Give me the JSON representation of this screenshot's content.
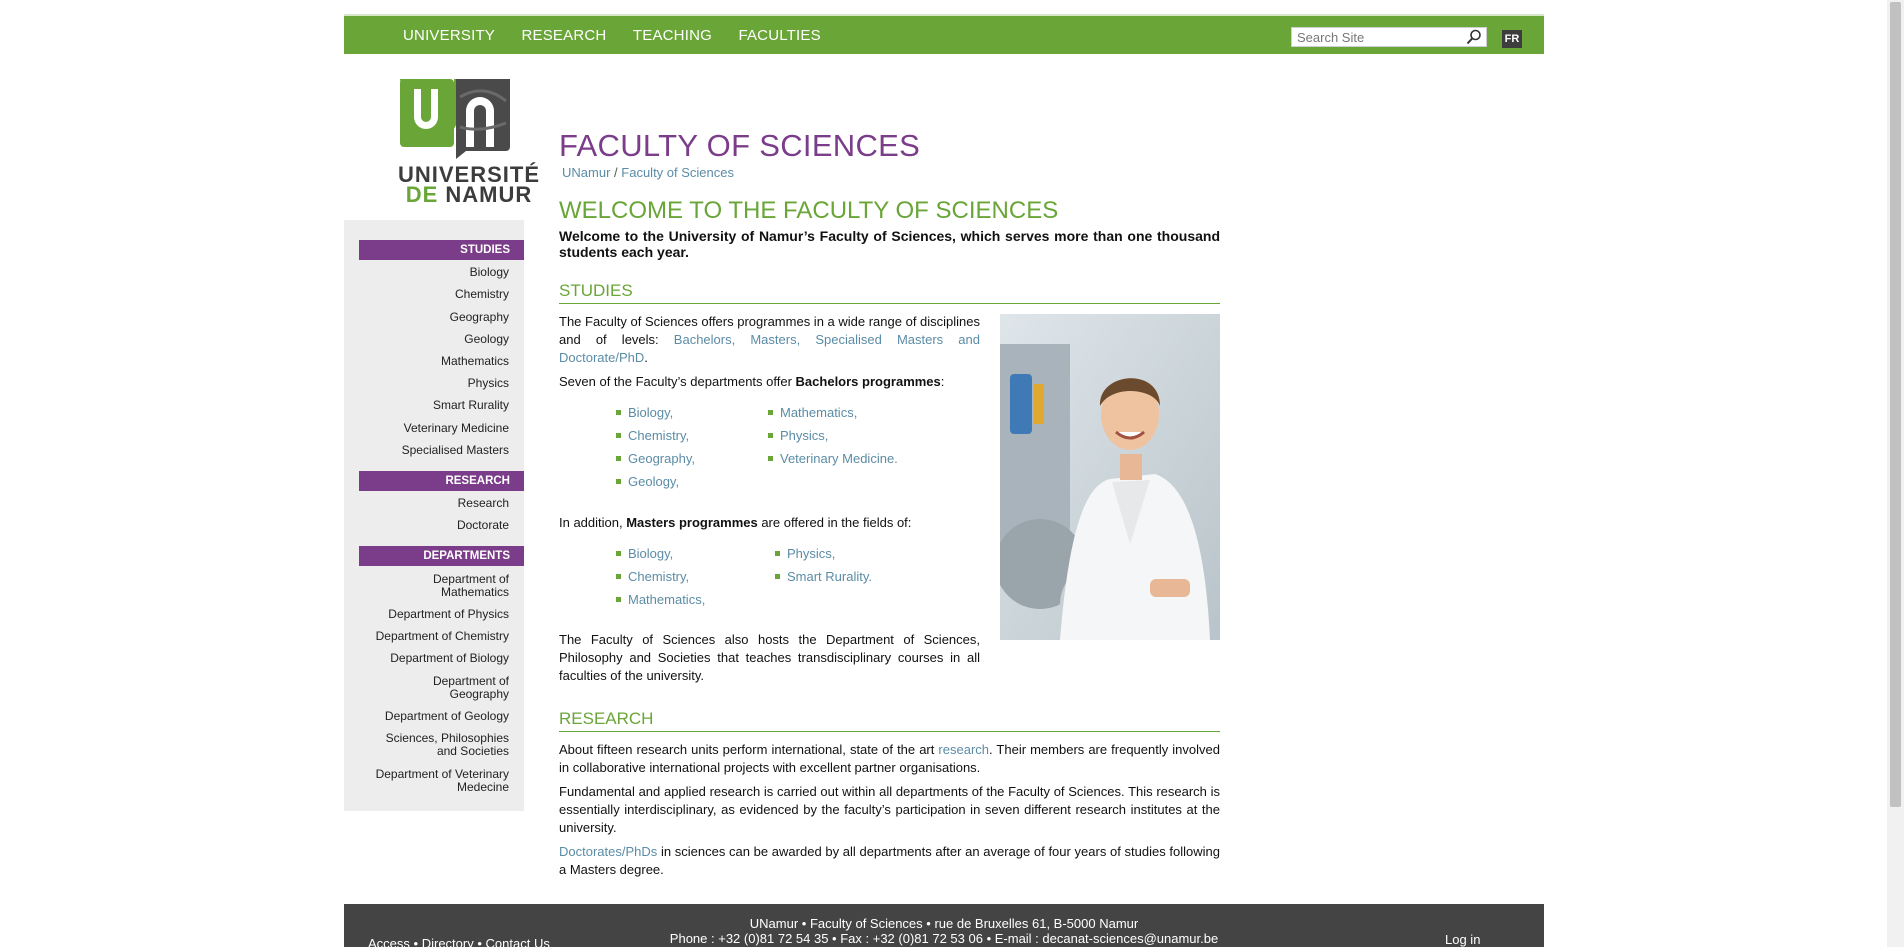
{
  "nav": {
    "items": [
      "UNIVERSITY",
      "RESEARCH",
      "TEACHING",
      "FACULTIES"
    ]
  },
  "search": {
    "placeholder": "Search Site"
  },
  "lang": "FR",
  "logo": {
    "line1": "UNIVERSITÉ",
    "line2a": "DE",
    "line2b": "NAMUR"
  },
  "sidebar": {
    "studies_head": "STUDIES",
    "studies": [
      "Biology",
      "Chemistry",
      "Geography",
      "Geology",
      "Mathematics",
      "Physics",
      "Smart Rurality",
      "Veterinary Medicine",
      "Specialised Masters"
    ],
    "research_head": "RESEARCH",
    "research": [
      "Research",
      "Doctorate"
    ],
    "departments_head": "DEPARTMENTS",
    "departments": [
      "Department of Mathematics",
      "Department of Physics",
      "Department of Chemistry",
      "Department of Biology",
      "Department of Geography",
      "Department of Geology",
      "Sciences, Philosophies and Societies",
      "Department of Veterinary Medecine"
    ]
  },
  "main": {
    "title": "FACULTY OF SCIENCES",
    "crumb_home": "UNamur",
    "crumb_sep": "/",
    "crumb_current": "Faculty of Sciences",
    "welcome": "WELCOME TO THE FACULTY OF SCIENCES",
    "intro": "Welcome to the University of Namur’s Faculty of Sciences, which serves more than one thousand students each year.",
    "studies_head": "STUDIES",
    "studies_p1a": "The Faculty of Sciences offers programmes in a wide range of disciplines and of levels: ",
    "studies_p1_link": "Bachelors, Masters, Specialised Masters and Doctorate/PhD",
    "studies_p1b": ".",
    "studies_p2a": "Seven of the Faculty’s departments offer ",
    "studies_p2_bold": "Bachelors programmes",
    "studies_p2b": ":",
    "bachelors_col1": [
      "Biology,",
      "Chemistry,",
      "Geography,",
      "Geology,"
    ],
    "bachelors_col2": [
      "Mathematics,",
      "Physics,",
      "Veterinary Medicine."
    ],
    "masters_pa": "In addition, ",
    "masters_bold": "Masters programmes",
    "masters_pb": " are offered in the fields of:",
    "masters_col1": [
      "Biology,",
      "Chemistry,",
      "Mathematics,"
    ],
    "masters_col2": [
      "Physics,",
      "Smart Rurality."
    ],
    "studies_p3": "The Faculty of Sciences also hosts the Department of Sciences, Philosophy and Societies that teaches transdisciplinary courses in all faculties of the university.",
    "research_head": "RESEARCH",
    "research_p1a": "About fifteen research units perform international, state of the art ",
    "research_p1_link": "research",
    "research_p1b": ". Their members are frequently involved in collaborative international projects with excellent partner organisations.",
    "research_p2": "Fundamental and applied research is carried out within all departments of the Faculty of Sciences.  This research is essentially interdisciplinary, as evidenced by the faculty’s participation in seven different research institutes at the university.",
    "research_p3_link": "Doctorates/PhDs",
    "research_p3b": " in sciences can be awarded by all departments after an average of four years of studies following a Masters degree."
  },
  "footer": {
    "line1": "UNamur • Faculty of Sciences • rue de Bruxelles 61, B-5000 Namur",
    "line2": "Phone : +32 (0)81 72 54 35 • Fax : +32 (0)81 72 53 06 • E-mail : decanat-sciences@unamur.be",
    "access": "Access",
    "directory": "Directory",
    "contact": "Contact Us",
    "dot": "•",
    "login": "Log in"
  },
  "colors": {
    "green": "#6aa537",
    "purple": "#7b3d8a",
    "link": "#5b8ca6",
    "footer": "#444444"
  }
}
